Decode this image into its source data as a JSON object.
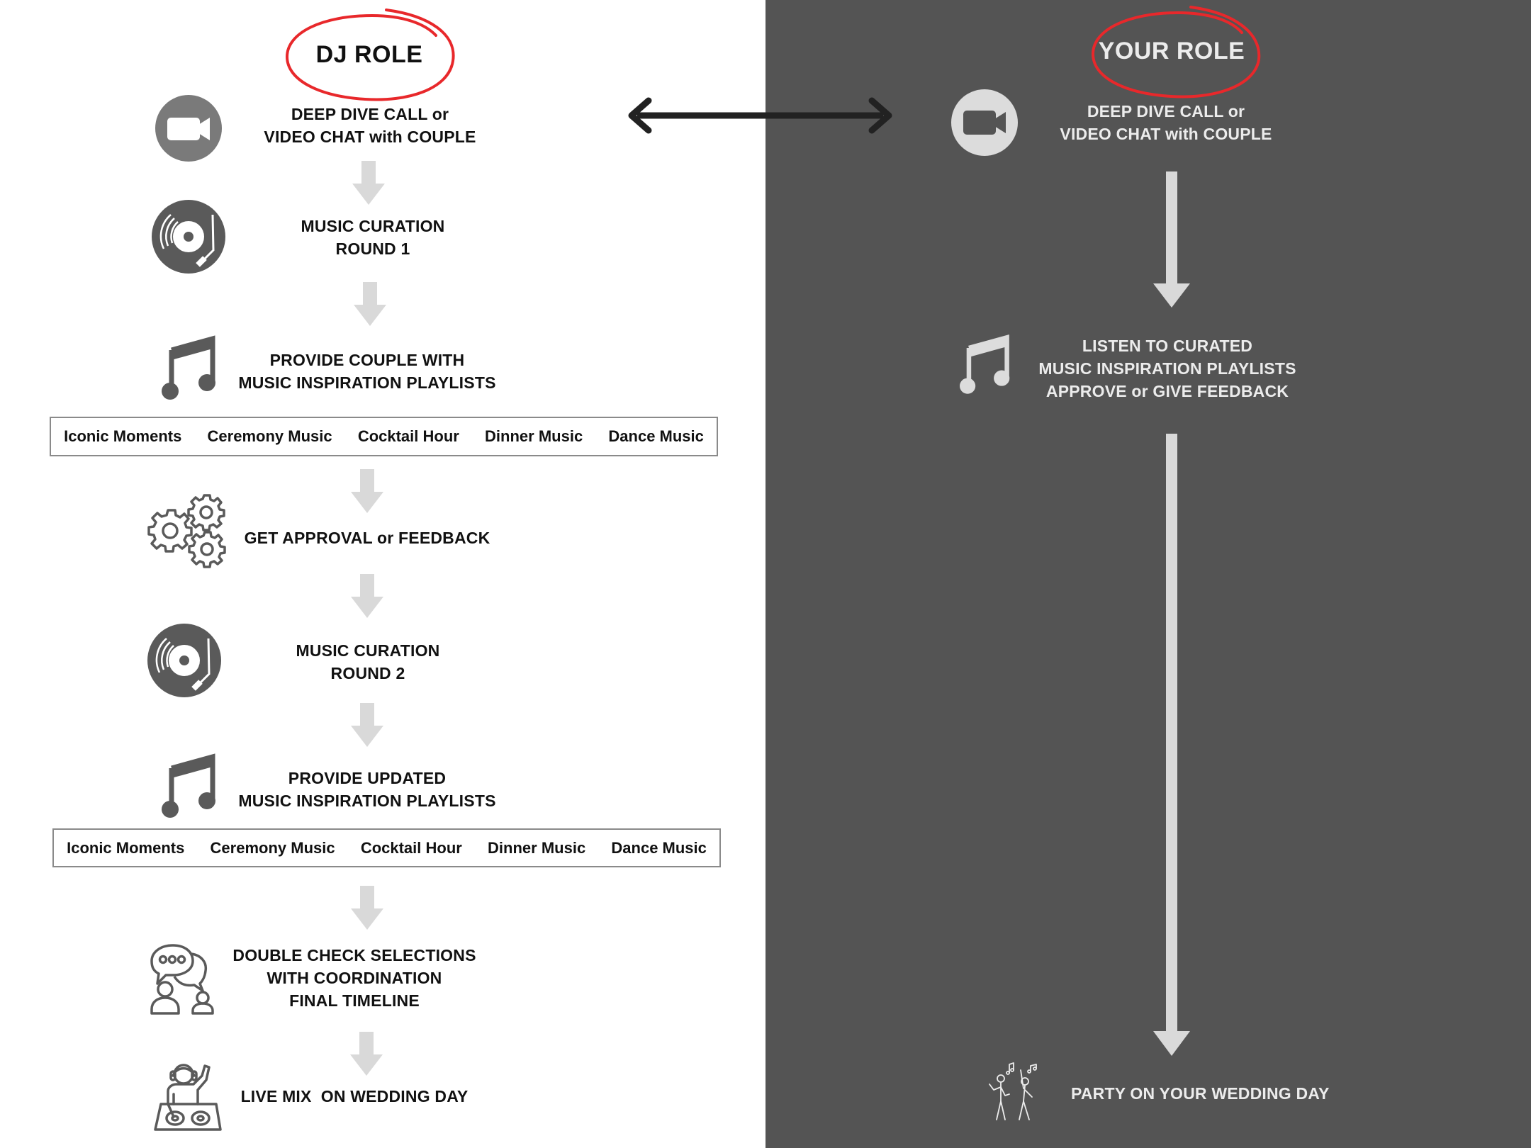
{
  "colors": {
    "left_bg": "#ffffff",
    "right_bg": "#545454",
    "accent_red": "#e8282b",
    "icon_dark": "#5a5a5a",
    "icon_light": "#dcdcdc",
    "arrow_gray": "#d9d9d9",
    "connector_black": "#222222"
  },
  "dj_role": {
    "title": "DJ ROLE",
    "steps": [
      {
        "icon": "video-camera-icon",
        "lines": [
          "DEEP DIVE CALL or",
          "VIDEO CHAT with COUPLE"
        ]
      },
      {
        "icon": "vinyl-record-icon",
        "lines": [
          "MUSIC CURATION",
          "ROUND 1"
        ]
      },
      {
        "icon": "music-note-icon",
        "lines": [
          "PROVIDE COUPLE WITH",
          "MUSIC INSPIRATION PLAYLISTS"
        ]
      },
      {
        "icon": "gears-icon",
        "lines": [
          "GET APPROVAL or FEEDBACK"
        ]
      },
      {
        "icon": "vinyl-record-icon",
        "lines": [
          "MUSIC CURATION",
          "ROUND 2"
        ]
      },
      {
        "icon": "music-note-icon",
        "lines": [
          "PROVIDE UPDATED",
          "MUSIC INSPIRATION PLAYLISTS"
        ]
      },
      {
        "icon": "conversation-icon",
        "lines": [
          "DOUBLE CHECK SELECTIONS",
          "WITH COORDINATION",
          "FINAL TIMELINE"
        ]
      },
      {
        "icon": "dj-mixer-icon",
        "lines": [
          "LIVE MIX  ON WEDDING DAY"
        ]
      }
    ],
    "playlists_round1": [
      "Iconic Moments",
      "Ceremony Music",
      "Cocktail Hour",
      "Dinner Music",
      "Dance Music"
    ],
    "playlists_round2": [
      "Iconic Moments",
      "Ceremony Music",
      "Cocktail Hour",
      "Dinner Music",
      "Dance Music"
    ]
  },
  "your_role": {
    "title": "YOUR ROLE",
    "steps": [
      {
        "icon": "video-camera-icon",
        "lines": [
          "DEEP DIVE CALL or",
          "VIDEO CHAT with COUPLE"
        ]
      },
      {
        "icon": "music-note-icon",
        "lines": [
          "LISTEN TO CURATED",
          "MUSIC INSPIRATION PLAYLISTS",
          "APPROVE or GIVE FEEDBACK"
        ]
      },
      {
        "icon": "dancing-people-icon",
        "lines": [
          "PARTY ON YOUR WEDDING DAY"
        ]
      }
    ]
  }
}
